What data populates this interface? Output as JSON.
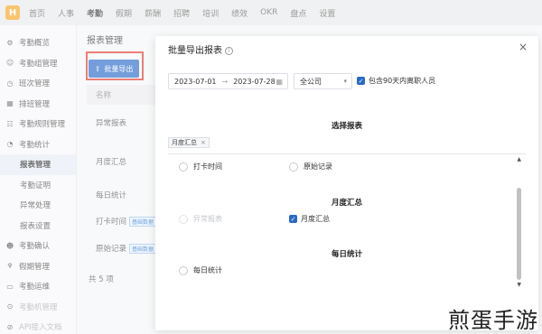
{
  "topnav": {
    "logo": "H",
    "items": [
      "首页",
      "人事",
      "考勤",
      "假期",
      "薪酬",
      "招聘",
      "培训",
      "绩效",
      "OKR",
      "盘点",
      "设置"
    ],
    "active_index": 2
  },
  "sidebar": {
    "items": [
      {
        "label": "考勤概览",
        "icon": "gear-icon"
      },
      {
        "label": "考勤组管理",
        "icon": "people-icon"
      },
      {
        "label": "班次管理",
        "icon": "clock-icon"
      },
      {
        "label": "排班管理",
        "icon": "calendar-icon"
      },
      {
        "label": "考勤规则管理",
        "icon": "rules-icon"
      },
      {
        "label": "考勤统计",
        "icon": "stats-icon"
      },
      {
        "label": "报表管理"
      },
      {
        "label": "考勤证明"
      },
      {
        "label": "异常处理"
      },
      {
        "label": "报表设置"
      },
      {
        "label": "考勤确认",
        "icon": "person-icon"
      },
      {
        "label": "假期管理",
        "icon": "tie-icon"
      },
      {
        "label": "考勤运维",
        "icon": "monitor-icon"
      },
      {
        "label": "考勤机管理",
        "icon": "device-icon"
      },
      {
        "label": "API接入文档",
        "icon": "doc-icon"
      }
    ]
  },
  "main": {
    "title": "报表管理",
    "export_button": "批量导出",
    "column_header": "名称",
    "rows": [
      {
        "label": "异常报表"
      },
      {
        "label": "月度汇总"
      },
      {
        "label": "每日统计"
      },
      {
        "label": "打卡时间",
        "tag": "基础数据"
      },
      {
        "label": "原始记录",
        "tag": "基础数据"
      }
    ],
    "total": "共 5 项"
  },
  "modal": {
    "title": "批量导出报表",
    "date_start": "2023-07-01",
    "date_end": "2023-07-28",
    "company_select": "全公司",
    "include_resigned_label": "包含90天内离职人员",
    "select_report_title": "选择报表",
    "selected_chip": "月度汇总",
    "options_basic": [
      {
        "label": "打卡时间",
        "checked": false
      },
      {
        "label": "原始记录",
        "checked": false
      }
    ],
    "monthly_title": "月度汇总",
    "options_monthly": [
      {
        "label": "异常报表",
        "disabled": true
      },
      {
        "label": "月度汇总",
        "checked": true
      }
    ],
    "daily_title": "每日统计",
    "options_daily": [
      {
        "label": "每日统计",
        "checked": false
      }
    ]
  },
  "watermark": "煎蛋手游",
  "colors": {
    "primary": "#2a6ac8",
    "highlight": "#e03a2f",
    "logo": "#f5a623"
  }
}
